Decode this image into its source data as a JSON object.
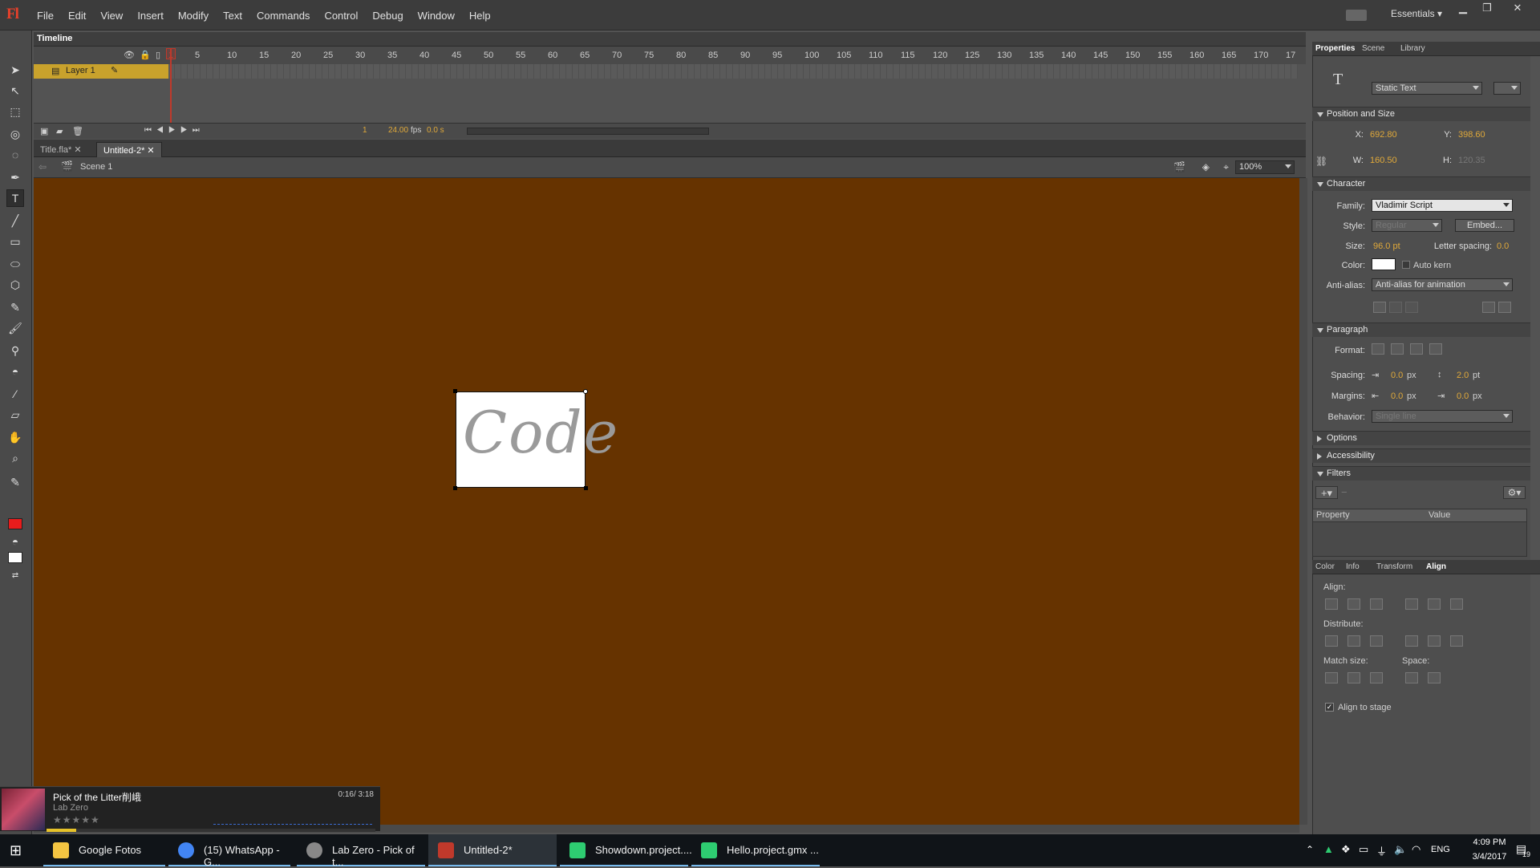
{
  "app": {
    "logo": "Fl",
    "menu": [
      "File",
      "Edit",
      "View",
      "Insert",
      "Modify",
      "Text",
      "Commands",
      "Control",
      "Debug",
      "Window",
      "Help"
    ],
    "workspace": "Essentials"
  },
  "timeline": {
    "tab": "Timeline",
    "ruler": [
      "1",
      "5",
      "10",
      "15",
      "20",
      "25",
      "30",
      "35",
      "40",
      "45",
      "50",
      "55",
      "60",
      "65",
      "70",
      "75",
      "80",
      "85",
      "90",
      "95",
      "100",
      "105",
      "110",
      "115",
      "120",
      "125",
      "130",
      "135",
      "140",
      "145",
      "150",
      "155",
      "160",
      "165",
      "170",
      "17"
    ],
    "layer_name": "Layer 1",
    "current_frame": "1",
    "fps": "24.00",
    "fps_unit": "fps",
    "time": "0.0 s"
  },
  "documents": {
    "tabs": [
      {
        "label": "Title.fla*",
        "active": false
      },
      {
        "label": "Untitled-2*",
        "active": true
      }
    ]
  },
  "editbar": {
    "scene": "Scene 1",
    "zoom": "100%"
  },
  "stage": {
    "background": "#663300",
    "text": "Code"
  },
  "properties": {
    "tabs": [
      "Properties",
      "Scene",
      "Library"
    ],
    "tool_icon": "T",
    "text_type": "Static Text",
    "position_title": "Position and Size",
    "x_label": "X:",
    "x": "692.80",
    "y_label": "Y:",
    "y": "398.60",
    "w_label": "W:",
    "w": "160.50",
    "h_label": "H:",
    "h": "120.35",
    "character_title": "Character",
    "family_label": "Family:",
    "family": "Vladimir Script",
    "style_label": "Style:",
    "style": "Regular",
    "embed": "Embed...",
    "size_label": "Size:",
    "size": "96.0 pt",
    "letter_spacing_label": "Letter spacing:",
    "letter_spacing": "0.0",
    "color_label": "Color:",
    "auto_kern": "Auto kern",
    "antialias_label": "Anti-alias:",
    "antialias": "Anti-alias for animation",
    "paragraph_title": "Paragraph",
    "format_label": "Format:",
    "spacing_label": "Spacing:",
    "spacing_indent": "0.0",
    "spacing_indent_unit": "px",
    "line_spacing": "2.0",
    "line_spacing_unit": "pt",
    "margins_label": "Margins:",
    "margin_left": "0.0",
    "margin_left_unit": "px",
    "margin_right": "0.0",
    "margin_right_unit": "px",
    "behavior_label": "Behavior:",
    "behavior": "Single line",
    "options_title": "Options",
    "accessibility_title": "Accessibility",
    "filters_title": "Filters",
    "filters_cols": [
      "Property",
      "Value"
    ]
  },
  "align_panel": {
    "tabs": [
      "Color",
      "Info",
      "Transform",
      "Align"
    ],
    "align_label": "Align:",
    "distribute_label": "Distribute:",
    "match_size_label": "Match size:",
    "space_label": "Space:",
    "align_to_stage": "Align to stage"
  },
  "music": {
    "title": "Pick of the Litter削峨",
    "artist": "Lab Zero",
    "time": "0:16/ 3:18",
    "rating_stars": 4,
    "progress": 0.09
  },
  "taskbar": {
    "items": [
      {
        "label": "Google Fotos",
        "icon": "folder-icon",
        "color": "#f4c542"
      },
      {
        "label": "(15) WhatsApp - G...",
        "icon": "chrome-icon",
        "color": "#4285f4"
      },
      {
        "label": "Lab Zero - Pick of t...",
        "icon": "media-player-icon",
        "color": "#888888"
      },
      {
        "label": "Untitled-2*",
        "icon": "flash-icon",
        "color": "#c0392b"
      },
      {
        "label": "Showdown.project....",
        "icon": "gamemaker-icon",
        "color": "#2ecc71"
      },
      {
        "label": "Hello.project.gmx ...",
        "icon": "gamemaker-icon",
        "color": "#2ecc71"
      }
    ],
    "lang": "ENG",
    "time": "4:09 PM",
    "date": "3/4/2017",
    "notifications": "19"
  }
}
